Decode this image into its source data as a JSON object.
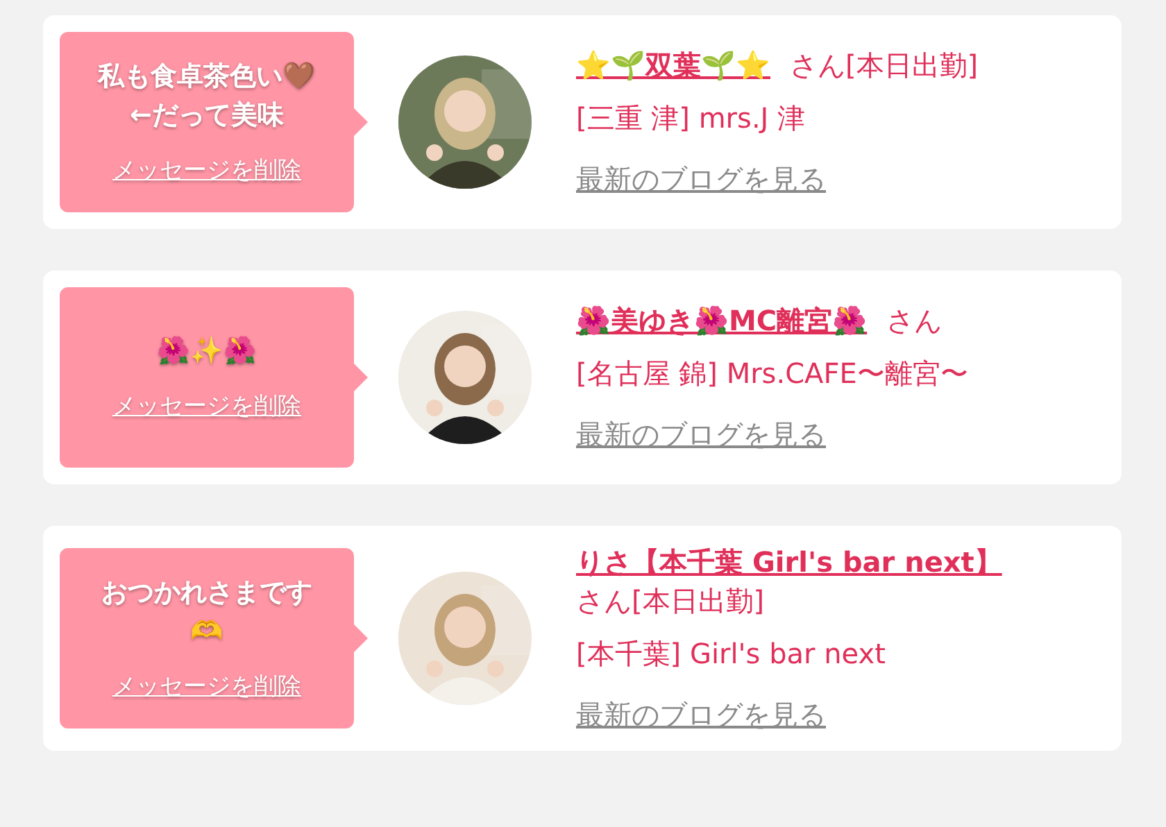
{
  "messages": [
    {
      "bubble_lines": [
        "私も食卓茶色い🤎",
        "←だって美味"
      ],
      "delete_link": "メッセージを削除",
      "avatar": {
        "kind": "picture"
      },
      "name": "⭐🌱双葉🌱⭐",
      "name_suffix": "さん[本日出勤]",
      "shop": "[三重 津] mrs.J 津",
      "blog_link": "最新のブログを見る"
    },
    {
      "bubble_lines": [
        "🌺✨🌺"
      ],
      "delete_link": "メッセージを削除",
      "avatar": {
        "kind": "picture"
      },
      "name": "🌺美ゆき🌺MC離宮🌺",
      "name_suffix": "さん",
      "shop": "[名古屋 錦] Mrs.CAFE〜離宮〜",
      "blog_link": "最新のブログを見る"
    },
    {
      "bubble_lines": [
        "おつかれさまです",
        "🫶"
      ],
      "delete_link": "メッセージを削除",
      "avatar": {
        "kind": "picture"
      },
      "name": "りさ【本千葉 Girl's bar next】",
      "name_suffix": "さん[本日出勤]",
      "shop": "[本千葉] Girl's bar next",
      "blog_link": "最新のブログを見る"
    }
  ]
}
